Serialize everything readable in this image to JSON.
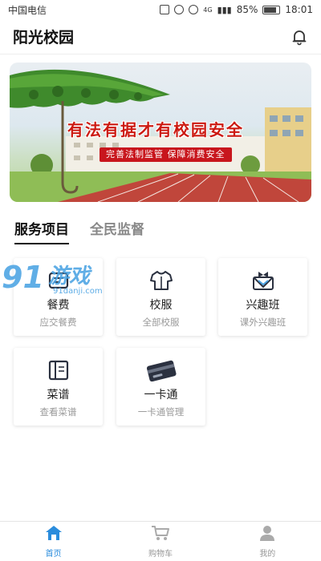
{
  "status_bar": {
    "carrier": "中国电信",
    "network": "4G",
    "battery": "85%",
    "time": "18:01"
  },
  "header": {
    "title": "阳光校园",
    "icon": "bell-icon"
  },
  "banner": {
    "headline": "有法有据才有校园安全",
    "subline": "完善法制监管   保障消费安全"
  },
  "tabs": [
    {
      "label": "服务项目",
      "active": true
    },
    {
      "label": "全民监督",
      "active": false
    }
  ],
  "services": [
    {
      "label": "餐费",
      "sub": "应交餐费",
      "icon": "meal-fee-icon"
    },
    {
      "label": "校服",
      "sub": "全部校服",
      "icon": "uniform-shirt-icon"
    },
    {
      "label": "兴趣班",
      "sub": "课外兴趣班",
      "icon": "interest-class-icon"
    },
    {
      "label": "菜谱",
      "sub": "查看菜谱",
      "icon": "menu-book-icon"
    },
    {
      "label": "一卡通",
      "sub": "一卡通管理",
      "icon": "campus-card-icon"
    }
  ],
  "watermark": {
    "brand": "91",
    "brand_cn": "游戏",
    "url": "91danji.com"
  },
  "bottom_nav": [
    {
      "label": "首页",
      "icon": "home-icon",
      "active": true
    },
    {
      "label": "购物车",
      "icon": "cart-icon",
      "active": false
    },
    {
      "label": "我的",
      "icon": "user-icon",
      "active": false
    }
  ],
  "colors": {
    "accent": "#2a8cdc",
    "banner_red": "#c8161d",
    "icon_dark": "#2b3140"
  }
}
